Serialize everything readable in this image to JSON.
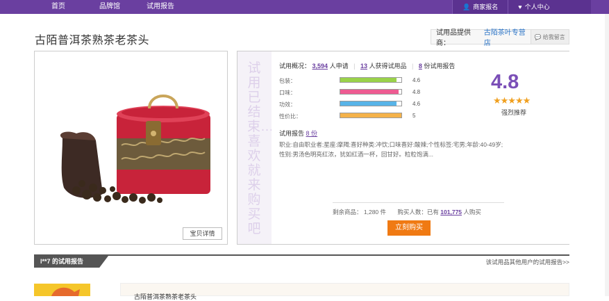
{
  "nav": {
    "items": [
      "首页",
      "品牌馆",
      "试用报告"
    ]
  },
  "top_right": {
    "merchant": "商家报名",
    "personal": "个人中心"
  },
  "product": {
    "title": "古陌普洱茶熟茶老茶头",
    "detail_button": "宝贝详情"
  },
  "supplier": {
    "label": "试用品提供商：",
    "shop": "古陌茶叶专营店",
    "message": "给我留言"
  },
  "status_vertical": "试用已结束…喜欢就来购买吧",
  "summary": {
    "label": "试用概况：",
    "applicants": "3,594",
    "applicants_suffix": "人申请",
    "winners": "13",
    "winners_suffix": "人获得试用品",
    "reports": "8",
    "reports_suffix": "份试用报告"
  },
  "ratings": [
    {
      "label": "包装：",
      "value": "4.6",
      "fraction": 0.92,
      "color": "#9ad24a"
    },
    {
      "label": "口味：",
      "value": "4.8",
      "fraction": 0.96,
      "color": "#ee5b92"
    },
    {
      "label": "功效：",
      "value": "4.6",
      "fraction": 0.92,
      "color": "#58b4e8"
    },
    {
      "label": "性价比：",
      "value": "5",
      "fraction": 1.0,
      "color": "#f4b24a"
    }
  ],
  "overall": {
    "score": "4.8",
    "stars": "★★★★★",
    "recommend": "强烈推荐"
  },
  "report": {
    "label": "试用报告",
    "count": "8 份",
    "text": "职业:自由职业者;星座:摩羯;喜好种类:冲饮;口味喜好:酸辣;个性标签:宅男;年龄:40-49岁;性别:男汤色明亮红浓，犹如红酒一杯，回甘好。粒粒饱满..."
  },
  "stock": {
    "remaining_label": "剩余商品：",
    "remaining": "1,280 件",
    "buyers_label": "购买人数：已有",
    "buyers": "101,775",
    "buyers_suffix": "人购买"
  },
  "buy_button": "立刻购买",
  "reports_section": {
    "tab": "l**7 的试用报告",
    "more": "该试用品其他用户的试用报告>>",
    "card_title": "古陌普洱茶熟茶老茶头"
  },
  "colors": {
    "brand": "#6a3fa0",
    "buy": "#f07a13",
    "link": "#2a73c6"
  }
}
